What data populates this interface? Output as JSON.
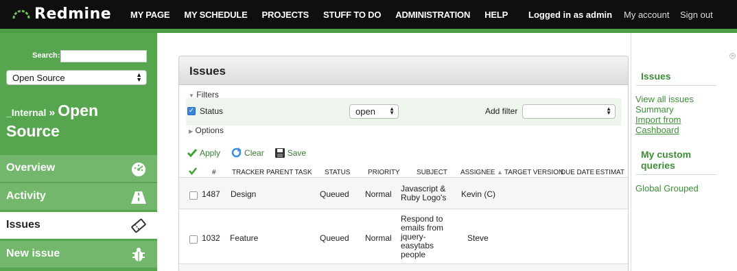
{
  "app": {
    "logo_text": "Redmine",
    "menu": [
      "MY PAGE",
      "MY SCHEDULE",
      "PROJECTS",
      "STUFF TO DO",
      "ADMINISTRATION",
      "HELP"
    ],
    "logged_in": "Logged in as admin",
    "account": "My account",
    "signout": "Sign out"
  },
  "sidebar": {
    "search_label": "Search:",
    "search_value": "",
    "project_select": "Open Source",
    "project_parent": "_Internal",
    "project_sep": "»",
    "project_name": "Open Source",
    "nav": [
      {
        "label": "Overview",
        "icon": "dashboard-icon"
      },
      {
        "label": "Activity",
        "icon": "road-icon"
      },
      {
        "label": "Issues",
        "icon": "ticket-icon"
      },
      {
        "label": "New issue",
        "icon": "bug-icon"
      }
    ]
  },
  "issues": {
    "title": "Issues",
    "filters_legend": "Filters",
    "status_label": "Status",
    "status_value": "open",
    "add_filter_label": "Add filter",
    "add_filter_value": "",
    "options_legend": "Options",
    "apply": "Apply",
    "clear": "Clear",
    "save": "Save",
    "columns": [
      "#",
      "TRACKER",
      "PARENT TASK",
      "STATUS",
      "PRIORITY",
      "SUBJECT",
      "ASSIGNEE",
      "TARGET VERSION",
      "DUE DATE",
      "ESTIMAT"
    ],
    "rows": [
      {
        "id": "1487",
        "tracker": "Design",
        "status": "Queued",
        "priority": "Normal",
        "subject": [
          "Javascript &",
          "Ruby Logo's"
        ],
        "assignee": "Kevin (C)"
      },
      {
        "id": "1032",
        "tracker": "Feature",
        "status": "Queued",
        "priority": "Normal",
        "subject": [
          "Respond to",
          "emails from",
          "jquery-",
          "easytabs",
          "people"
        ],
        "assignee": "Steve"
      }
    ]
  },
  "right_sidebar": {
    "issues_heading": "Issues",
    "links": [
      "View all issues",
      "Summary",
      "Import from",
      "Cashboard"
    ],
    "custom_heading": [
      "My custom",
      "queries"
    ],
    "custom_links": [
      "Global Grouped"
    ]
  },
  "colors": {
    "accent_green": "#56a650",
    "link_green": "#3d8f37",
    "topbar": "#0f0f0f"
  }
}
